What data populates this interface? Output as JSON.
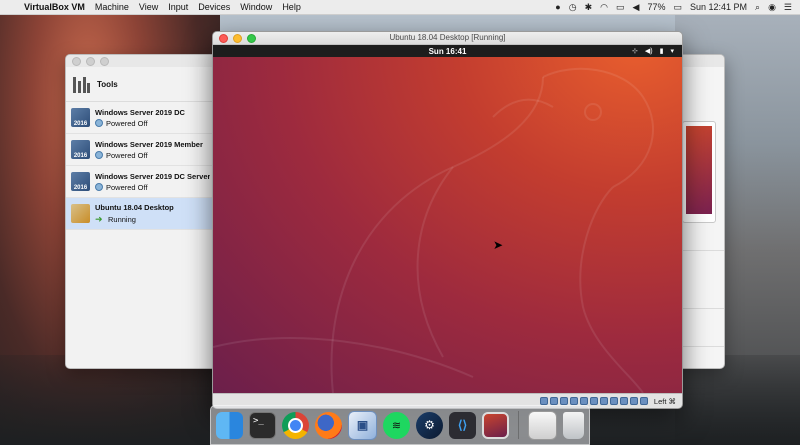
{
  "menubar": {
    "apple_symbol": "",
    "app_name": "VirtualBox VM",
    "menus": [
      "Machine",
      "View",
      "Input",
      "Devices",
      "Window",
      "Help"
    ],
    "battery": "77%",
    "clock": "Sun 12:41 PM"
  },
  "vbox_manager": {
    "tools_label": "Tools",
    "vms": [
      {
        "name": "Windows Server 2019 DC",
        "status": "Powered Off",
        "badge": "2016"
      },
      {
        "name": "Windows Server 2019 Member",
        "status": "Powered Off",
        "badge": "2016"
      },
      {
        "name": "Windows Server 2019 DC Server",
        "status": "Powered Off",
        "badge": "2016"
      },
      {
        "name": "Ubuntu 18.04 Desktop",
        "status": "Running",
        "badge": ""
      }
    ]
  },
  "vm_window": {
    "title": "Ubuntu 18.04 Desktop [Running]",
    "guest_clock": "Sun 16:41",
    "host_key": "Left ⌘"
  },
  "colors": {
    "ubuntu_orange": "#e85e2e",
    "ubuntu_purple": "#6b1f4b",
    "selection": "#cfe0f7"
  },
  "dock": {
    "apps": [
      "finder-icon",
      "terminal-icon",
      "chrome-icon",
      "firefox-icon",
      "virtualbox-icon",
      "spotify-icon",
      "steam-icon",
      "vscode-icon",
      "vm-preview-icon",
      "documents-icon",
      "trash-icon"
    ],
    "terminal_glyph": ">_",
    "vscode_glyph": "⟨⟩"
  }
}
